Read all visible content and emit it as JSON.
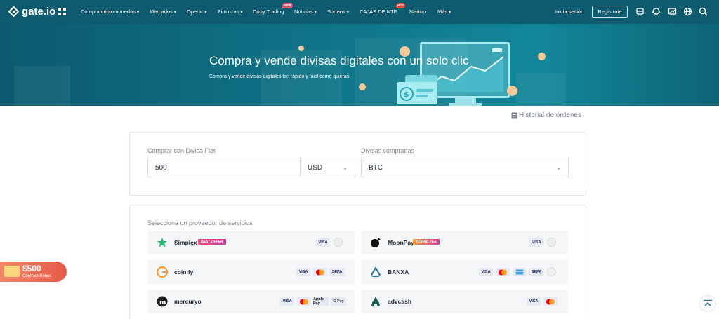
{
  "nav": {
    "logo_text": "gate.io",
    "items": [
      {
        "label": "Compra criptomonedas",
        "has_dropdown": true
      },
      {
        "label": "Mercados",
        "has_dropdown": true
      },
      {
        "label": "Operar",
        "has_dropdown": true
      },
      {
        "label": "Finanzas",
        "has_dropdown": true
      },
      {
        "label": "Copy Trading",
        "has_dropdown": false,
        "badge": "NEW"
      },
      {
        "label": "Noticias",
        "has_dropdown": true
      },
      {
        "label": "Sorteos",
        "has_dropdown": true
      },
      {
        "label": "CAJAS DE NTF",
        "has_dropdown": false,
        "badge": "HOT"
      },
      {
        "label": "Startup",
        "has_dropdown": false
      },
      {
        "label": "Más",
        "has_dropdown": true
      }
    ],
    "login": "Inicia sesión",
    "register": "Registrate",
    "icons": [
      "download-icon",
      "support-icon",
      "chart-icon",
      "globe-icon",
      "search-icon"
    ]
  },
  "hero": {
    "title": "Compra y vende divisas digitales con un solo clic",
    "subtitle": "Compra y vende divisas digitales tan rápido y fácil como quieras"
  },
  "history": {
    "label": "Historial de órdenes"
  },
  "form": {
    "fiat_label": "Comprar con Divisa Fiat",
    "fiat_amount": "500",
    "fiat_currency": "USD",
    "crypto_label": "Divisas compradas",
    "crypto_currency": "BTC"
  },
  "providers": {
    "label": "Selecciona un proveedor de servicios",
    "list": [
      {
        "name": "Simplex",
        "tag": "BEST OFFER",
        "methods": [
          "VISA"
        ]
      },
      {
        "name": "MoonPay",
        "tag": "0 CARD FEE",
        "methods": [
          "VISA"
        ]
      },
      {
        "name": "coinify",
        "tag": "",
        "methods": [
          "VISA",
          "MASTERCARD",
          "SEPA"
        ]
      },
      {
        "name": "BANXA",
        "tag": "",
        "methods": [
          "VISA",
          "MASTERCARD",
          "CARD",
          "SEPA"
        ]
      },
      {
        "name": "mercuryo",
        "tag": "",
        "methods": [
          "VISA",
          "MASTERCARD",
          "Apple Pay",
          "G Pay"
        ]
      },
      {
        "name": "advcash",
        "tag": "",
        "methods": [
          "VISA",
          "MASTERCARD"
        ]
      }
    ]
  },
  "bonus": {
    "amount": "$500",
    "label": "Contract Bonus"
  },
  "colors": {
    "nav_bg": "#0e5a6e",
    "hero_bg": "#0f7488",
    "accent_pink": "#e8507a",
    "bonus": "#e65a48"
  }
}
